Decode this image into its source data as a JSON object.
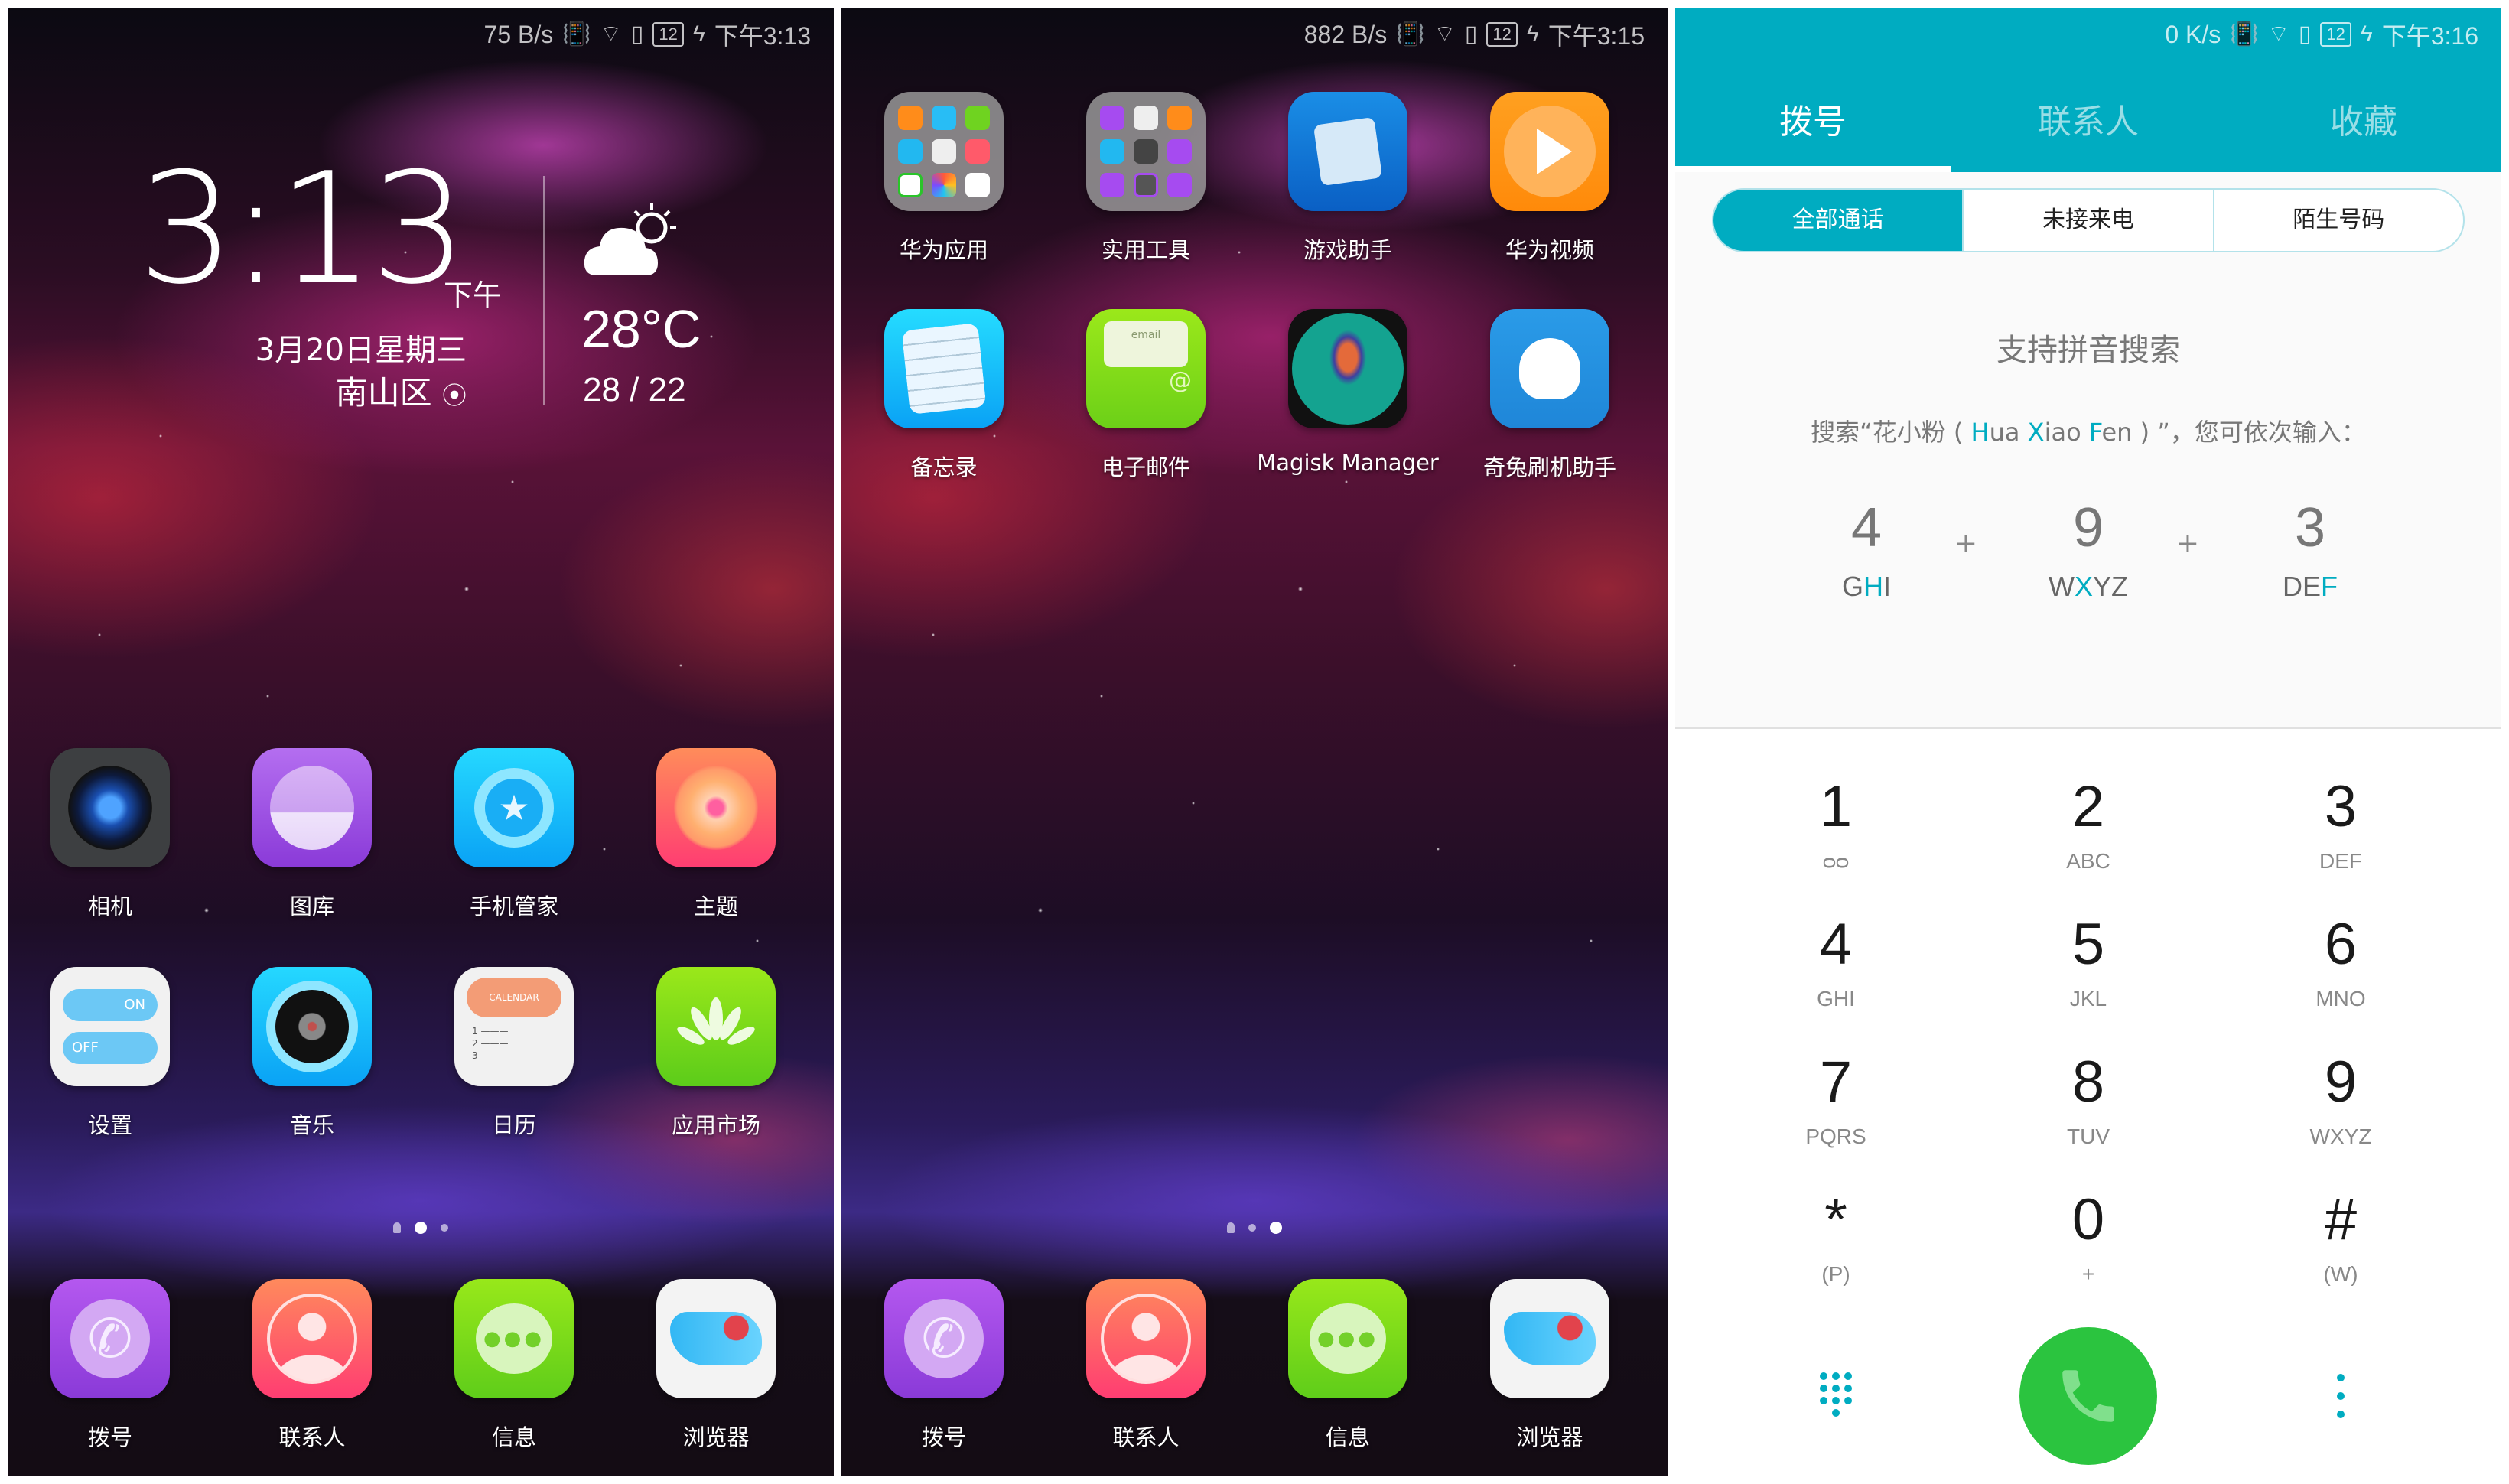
{
  "screens": [
    {
      "status": {
        "speed": "75 B/s",
        "battery": "12",
        "time": "下午3:13"
      },
      "clock": {
        "time": "3:13",
        "ampm": "下午",
        "date": "3月20日星期三",
        "location": "南山区",
        "temperature": "28°C",
        "range": "28 / 22",
        "weather_icon": "partly-cloudy-icon"
      },
      "apps": [
        {
          "label": "相机",
          "icon": "camera-icon"
        },
        {
          "label": "图库",
          "icon": "gallery-icon"
        },
        {
          "label": "手机管家",
          "icon": "phone-manager-icon"
        },
        {
          "label": "主题",
          "icon": "themes-icon"
        },
        {
          "label": "设置",
          "icon": "settings-icon"
        },
        {
          "label": "音乐",
          "icon": "music-icon"
        },
        {
          "label": "日历",
          "icon": "calendar-icon",
          "icon_text": "CALENDAR"
        },
        {
          "label": "应用市场",
          "icon": "app-market-icon"
        }
      ],
      "page_indicator": {
        "pages": 2,
        "current": 1
      },
      "dock": [
        {
          "label": "拨号",
          "icon": "dialer-icon"
        },
        {
          "label": "联系人",
          "icon": "contacts-icon"
        },
        {
          "label": "信息",
          "icon": "messages-icon"
        },
        {
          "label": "浏览器",
          "icon": "browser-icon"
        }
      ]
    },
    {
      "status": {
        "speed": "882 B/s",
        "battery": "12",
        "time": "下午3:15"
      },
      "apps": [
        {
          "label": "华为应用",
          "icon": "folder-icon",
          "type": "folder"
        },
        {
          "label": "实用工具",
          "icon": "folder-icon",
          "type": "folder"
        },
        {
          "label": "游戏助手",
          "icon": "game-assistant-icon"
        },
        {
          "label": "华为视频",
          "icon": "huawei-video-icon"
        },
        {
          "label": "备忘录",
          "icon": "notes-icon"
        },
        {
          "label": "电子邮件",
          "icon": "email-icon",
          "icon_text": "email"
        },
        {
          "label": "Magisk Manager",
          "icon": "magisk-icon"
        },
        {
          "label": "奇兔刷机助手",
          "icon": "qitu-flash-icon"
        }
      ],
      "page_indicator": {
        "pages": 2,
        "current": 2
      },
      "dock": [
        {
          "label": "拨号",
          "icon": "dialer-icon"
        },
        {
          "label": "联系人",
          "icon": "contacts-icon"
        },
        {
          "label": "信息",
          "icon": "messages-icon"
        },
        {
          "label": "浏览器",
          "icon": "browser-icon"
        }
      ]
    },
    {
      "status": {
        "speed": "0 K/s",
        "battery": "12",
        "time": "下午3:16"
      },
      "tabs": [
        {
          "label": "拨号",
          "active": true
        },
        {
          "label": "联系人",
          "active": false
        },
        {
          "label": "收藏",
          "active": false
        }
      ],
      "filters": [
        {
          "label": "全部通话",
          "active": true
        },
        {
          "label": "未接来电",
          "active": false
        },
        {
          "label": "陌生号码",
          "active": false
        }
      ],
      "hint": {
        "title": "支持拼音搜索",
        "prefix": "搜索“花小粉 ( ",
        "w1_first": "H",
        "w1_rest": "ua ",
        "w2_first": "X",
        "w2_rest": "iao ",
        "w3_first": "F",
        "w3_rest": "en",
        "suffix": " ) ”，您可依次输入："
      },
      "example": [
        {
          "num": "4",
          "pre": "G",
          "hl": "H",
          "post": "I"
        },
        {
          "num": "9",
          "pre": "W",
          "hl": "X",
          "post": "YZ"
        },
        {
          "num": "3",
          "pre": "DE",
          "hl": "F",
          "post": ""
        }
      ],
      "example_plus": "+",
      "keys": [
        {
          "num": "1",
          "sub": "voicemail"
        },
        {
          "num": "2",
          "sub": "ABC"
        },
        {
          "num": "3",
          "sub": "DEF"
        },
        {
          "num": "4",
          "sub": "GHI"
        },
        {
          "num": "5",
          "sub": "JKL"
        },
        {
          "num": "6",
          "sub": "MNO"
        },
        {
          "num": "7",
          "sub": "PQRS"
        },
        {
          "num": "8",
          "sub": "TUV"
        },
        {
          "num": "9",
          "sub": "WXYZ"
        },
        {
          "num": "*",
          "sub": "(P)"
        },
        {
          "num": "0",
          "sub": "+"
        },
        {
          "num": "#",
          "sub": "(W)"
        }
      ],
      "accent": "#00acc1",
      "call_color": "#2bc43f"
    }
  ]
}
